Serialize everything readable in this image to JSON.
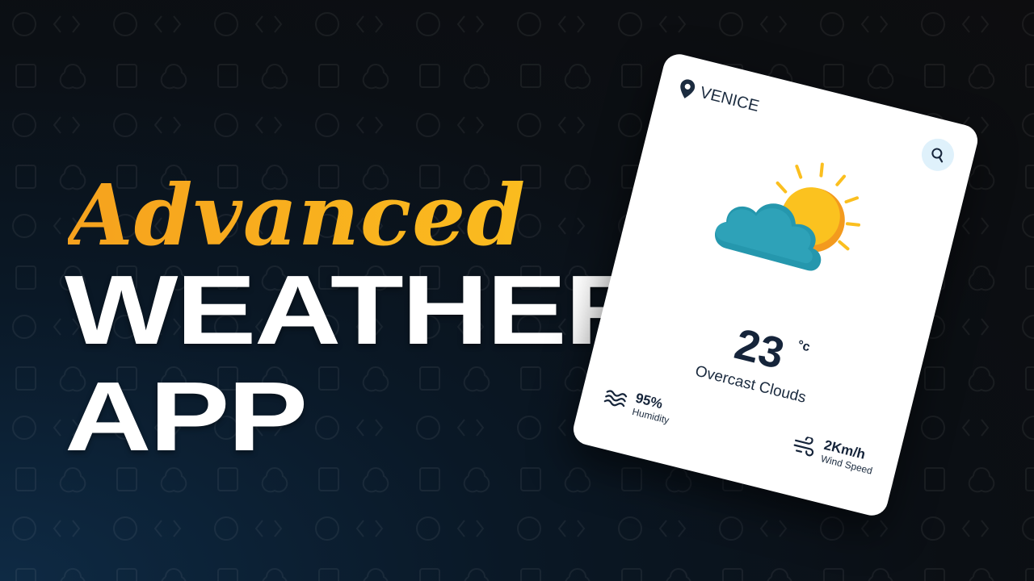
{
  "headline": {
    "script": "Advanced",
    "line2": "WEATHER",
    "line3": "APP"
  },
  "card": {
    "location": "VENICE",
    "temperature": "23",
    "unit": "°c",
    "condition": "Overcast Clouds",
    "humidity": {
      "value": "95%",
      "label": "Humidity"
    },
    "wind": {
      "value": "2Km/h",
      "label": "Wind Speed"
    }
  },
  "colors": {
    "accent": "#f6a21e",
    "card_text": "#15243a",
    "cloud": "#2ea2b8",
    "sun": "#fbbf1f"
  },
  "icons": [
    "location-pin-icon",
    "search-icon",
    "sun-cloud-icon",
    "humidity-waves-icon",
    "wind-icon"
  ]
}
